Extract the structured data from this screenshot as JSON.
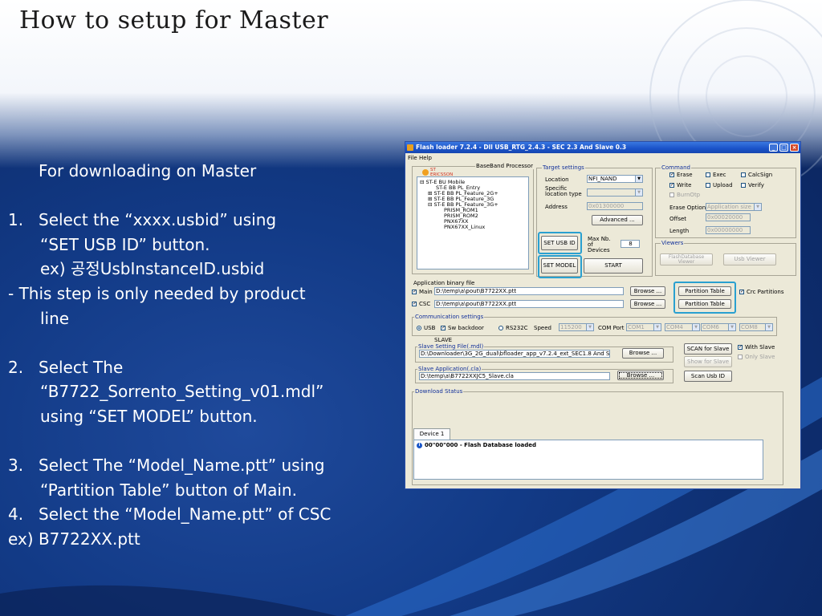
{
  "slide": {
    "title": "How to setup for Master",
    "lines": [
      {
        "kind": "heading",
        "text": "For downloading on Master"
      },
      {
        "kind": "blank",
        "text": ""
      },
      {
        "kind": "item",
        "num": "1.",
        "text": "Select the “xxxx.usbid” using"
      },
      {
        "kind": "cont",
        "text": " “SET USB ID” button."
      },
      {
        "kind": "cont",
        "text": "ex) 공정UsbInstanceID.usbid"
      },
      {
        "kind": "plain",
        "text": "- This step is only needed by product"
      },
      {
        "kind": "cont",
        "text": "line"
      },
      {
        "kind": "blank",
        "text": ""
      },
      {
        "kind": "item",
        "num": "2.",
        "text": "Select The"
      },
      {
        "kind": "cont",
        "text": "“B7722_Sorrento_Setting_v01.mdl”"
      },
      {
        "kind": "cont",
        "text": "using “SET MODEL” button."
      },
      {
        "kind": "blank",
        "text": ""
      },
      {
        "kind": "item",
        "num": "3.",
        "text": "Select The “Model_Name.ptt” using"
      },
      {
        "kind": "cont",
        "text": "“Partition Table” button of Main."
      },
      {
        "kind": "item",
        "num": "4.",
        "text": "Select the “Model_Name.ptt” of CSC"
      },
      {
        "kind": "plain",
        "text": "ex) B7722XX.ptt"
      }
    ],
    "colors": {
      "background": "#123a86",
      "text": "#ffffff",
      "highlight": "#2aa0d0"
    }
  },
  "app": {
    "title": "Flash loader 7.2.4 - Dll USB_RTG_2.4.3 - SEC 2.3 And Slave 0.3",
    "menu": [
      "File",
      "Help"
    ],
    "baseband": {
      "logo_text": "ST ERICSSON",
      "label": "BaseBand Processor",
      "tree": [
        "ST-E BU Mobile",
        "ST-E BB PL_Entry",
        "ST-E BB PL_Feature_2G+",
        "ST-E BB PL_Feature_3G",
        "ST-E BB PL_Feature_3G+",
        "PRISM_ROM1",
        "PRISM_ROM2",
        "PNX67XX",
        "PNX67XX_Linux"
      ]
    },
    "target": {
      "caption": "Target settings",
      "location_label": "Location",
      "location_value": "NFI_NAND",
      "specific_label": "Specific location type",
      "address_label": "Address",
      "address_value": "0x01300000",
      "advanced": "Advanced ...",
      "set_usb_id": "SET USB ID",
      "max_label": "Max Nb. of Devices",
      "max_value": "8",
      "set_model": "SET MODEL",
      "start": "START"
    },
    "command": {
      "caption": "Command",
      "erase": "Erase",
      "exec": "Exec",
      "calcsign": "CalcSign",
      "write": "Write",
      "upload": "Upload",
      "verify": "Verify",
      "burnotp": "BurnOtp",
      "erase_option_label": "Erase Option",
      "erase_option_value": "Application size",
      "offset_label": "Offset",
      "offset_value": "0x00020000",
      "length_label": "Length",
      "length_value": "0x00000000"
    },
    "viewers": {
      "caption": "Viewers",
      "flash_db": "FlashDatabase Viewer",
      "usb": "Usb Viewer"
    },
    "binary": {
      "caption": "Application binary file",
      "main_label": "Main",
      "main_path": "D:\\temp\\a\\pout\\B7722XX.ptt",
      "csc_label": "CSC",
      "csc_path": "D:\\temp\\a\\pout\\B7722XX.ptt",
      "browse": "Browse ...",
      "partition": "Partition Table",
      "crc": "Crc Partitions"
    },
    "comm": {
      "caption": "Communication settings",
      "usb": "USB",
      "sw_backdoor": "Sw backdoor",
      "rs232": "RS232C",
      "speed_label": "Speed",
      "speed_value": "115200",
      "comport_label": "COM Port",
      "ports": [
        "COM1",
        "COM4",
        "COM6",
        "COM8"
      ]
    },
    "slave": {
      "caption": "SLAVE",
      "setting_caption": "Slave Setting File(.mdl)",
      "setting_path": "D:\\Downloader\\3G_2G_dual\\bfloader_app_v7.2.4_ext_SEC1.8 And Slave 0",
      "app_caption": "Slave Application(.cla)",
      "app_path": "D:\\temp\\a\\B7722XXJC5_Slave.cla",
      "browse": "Browse ...",
      "scan_for_slave": "SCAN for Slave",
      "show_for_slave": "Show for Slave",
      "scan_usb_id": "Scan Usb ID",
      "with_slave": "With Slave",
      "only_slave": "Only Slave"
    },
    "download": {
      "caption": "Download Status",
      "tab": "Device 1",
      "log": "00\"00\"000 - Flash Database loaded"
    }
  }
}
